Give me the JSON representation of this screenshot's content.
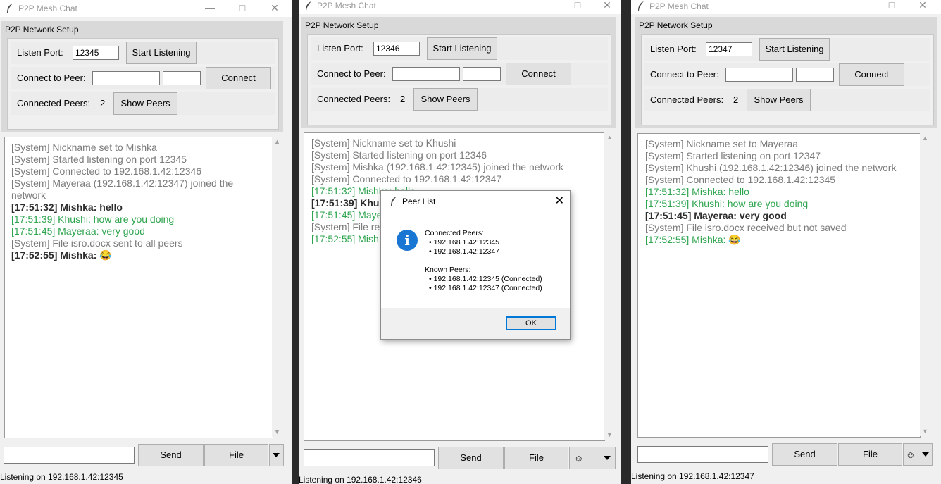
{
  "windows": [
    {
      "title": "P2P Mesh Chat",
      "frame_label": "P2P Network Setup",
      "listen_label": "Listen Port:",
      "listen_value": "12345",
      "start_button": "Start Listening",
      "connect_label": "Connect to Peer:",
      "connect_button": "Connect",
      "peers_label": "Connected Peers:",
      "peers_count": "2",
      "show_peers_button": "Show Peers",
      "messages": [
        {
          "text": "[System] Nickname set to Mishka",
          "style": "sys"
        },
        {
          "text": "[System] Started listening on port 12345",
          "style": "sys"
        },
        {
          "text": "[System] Connected to 192.168.1.42:12346",
          "style": "sys"
        },
        {
          "text": "[System] Mayeraa (192.168.1.42:12347) joined the network",
          "style": "sys"
        },
        {
          "text": "[17:51:32] Mishka: hello",
          "style": "bold"
        },
        {
          "text": "[17:51:39] Khushi: how are you doing",
          "style": "grn"
        },
        {
          "text": "[17:51:45] Mayeraa: very good",
          "style": "grn"
        },
        {
          "text": "[System] File isro.docx sent to all peers",
          "style": "sys"
        },
        {
          "text": "[17:52:55] Mishka: 😂",
          "style": "bold"
        }
      ],
      "send_button": "Send",
      "file_button": "File",
      "status": "Listening on 192.168.1.42:12345"
    },
    {
      "title": "P2P Mesh Chat",
      "frame_label": "P2P Network Setup",
      "listen_label": "Listen Port:",
      "listen_value": "12346",
      "start_button": "Start Listening",
      "connect_label": "Connect to Peer:",
      "connect_button": "Connect",
      "peers_label": "Connected Peers:",
      "peers_count": "2",
      "show_peers_button": "Show Peers",
      "messages": [
        {
          "text": "[System] Nickname set to Khushi",
          "style": "sys"
        },
        {
          "text": "[System] Started listening on port 12346",
          "style": "sys"
        },
        {
          "text": "[System] Mishka (192.168.1.42:12345) joined the network",
          "style": "sys"
        },
        {
          "text": "[System] Connected to 192.168.1.42:12347",
          "style": "sys"
        },
        {
          "text": "[17:51:32] Mishka: hello",
          "style": "grn"
        },
        {
          "text": "[17:51:39] Khu",
          "style": "bold"
        },
        {
          "text": "[17:51:45] Maye",
          "style": "grn"
        },
        {
          "text": "[System] File re",
          "style": "sys"
        },
        {
          "text": "[17:52:55] Mish",
          "style": "grn"
        }
      ],
      "send_button": "Send",
      "file_button": "File",
      "emoji_value": "☺",
      "status": "Listening on 192.168.1.42:12346"
    },
    {
      "title": "P2P Mesh Chat",
      "frame_label": "P2P Network Setup",
      "listen_label": "Listen Port:",
      "listen_value": "12347",
      "start_button": "Start Listening",
      "connect_label": "Connect to Peer:",
      "connect_button": "Connect",
      "peers_label": "Connected Peers:",
      "peers_count": "2",
      "show_peers_button": "Show Peers",
      "messages": [
        {
          "text": "[System] Nickname set to Mayeraa",
          "style": "sys"
        },
        {
          "text": "[System] Started listening on port 12347",
          "style": "sys"
        },
        {
          "text": "[System] Khushi (192.168.1.42:12346) joined the network",
          "style": "sys"
        },
        {
          "text": "[System] Connected to 192.168.1.42:12345",
          "style": "sys"
        },
        {
          "text": "[17:51:32] Mishka: hello",
          "style": "grn"
        },
        {
          "text": "[17:51:39] Khushi: how are you doing",
          "style": "grn"
        },
        {
          "text": "[17:51:45] Mayeraa: very good",
          "style": "bold"
        },
        {
          "text": "[System] File isro.docx received but not saved",
          "style": "sys"
        },
        {
          "text": "[17:52:55] Mishka: 😂",
          "style": "grn"
        }
      ],
      "send_button": "Send",
      "file_button": "File",
      "emoji_value": "☺",
      "status": "Listening on 192.168.1.42:12347"
    }
  ],
  "dialog": {
    "title": "Peer List",
    "connected_heading": "Connected Peers:",
    "connected": [
      "• 192.168.1.42:12345",
      "• 192.168.1.42:12347"
    ],
    "known_heading": "Known Peers:",
    "known": [
      "• 192.168.1.42:12345 (Connected)",
      "• 192.168.1.42:12347 (Connected)"
    ],
    "ok_button": "OK"
  },
  "icons": {
    "app": "feather-icon",
    "info": "info-icon",
    "minimize": "minimize-icon",
    "maximize": "maximize-icon",
    "close": "close-icon"
  },
  "colors": {
    "system_text": "#7b7b7b",
    "peer_text": "#2ea44f",
    "own_text": "#2d2d2d",
    "info_blue": "#1976d2"
  }
}
